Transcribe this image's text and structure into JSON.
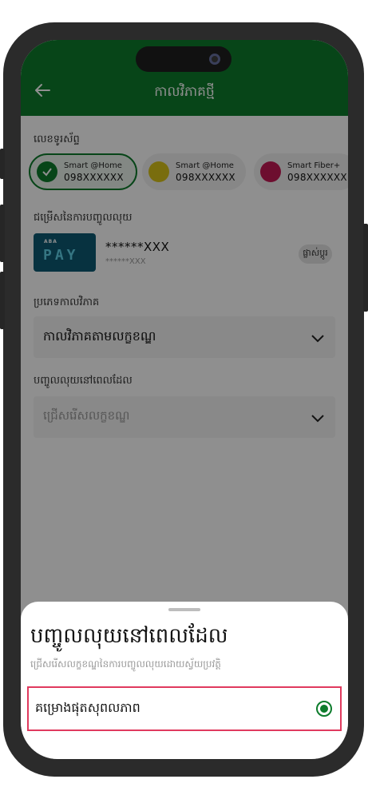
{
  "header": {
    "title": "កាលវិភាគថ្មី",
    "back_icon": "arrow-left-icon"
  },
  "phone_section": {
    "label": "លេខទូរស័ព្ទ",
    "chips": [
      {
        "name": "Smart @Home",
        "number": "098XXXXXX",
        "selected": true,
        "icon": "check-icon",
        "color": "#0d7c2c"
      },
      {
        "name": "Smart @Home",
        "number": "098XXXXXX",
        "selected": false,
        "icon": "smart-home-logo-icon",
        "color": "#d8c21a"
      },
      {
        "name": "Smart Fiber+",
        "number": "098XXXXXX",
        "selected": false,
        "icon": "smart-fiber-logo-icon",
        "color": "#c21a55"
      }
    ]
  },
  "payment_section": {
    "label": "ជម្រើសនៃការបញ្ចូលលុយ",
    "card_brand_top": "ABA",
    "card_brand": "PAY",
    "account_masked": "******XXX",
    "account_sub": "******XXX",
    "change_label": "ផ្លាស់ប្ដូរ"
  },
  "schedule_type": {
    "label": "ប្រភេទកាលវិភាគ",
    "value": "កាលវិភាគតាមលក្ខខណ្ឌ"
  },
  "topup_when": {
    "label": "បញ្ចូលលុយនៅពេលដែល",
    "placeholder": "ជ្រើសរើសលក្ខខណ្ឌ"
  },
  "sheet": {
    "title": "បញ្ចូលលុយនៅពេលដែល",
    "subtitle": "ជ្រើសរើសលក្ខខណ្ឌនៃការបញ្ចូលលុយដោយស្វ័យប្រវត្តិ",
    "option_label": "គម្រោងផុតសុពលភាព",
    "option_selected": true
  },
  "colors": {
    "brand_green": "#0d7c2c",
    "highlight": "#e03a5e"
  }
}
